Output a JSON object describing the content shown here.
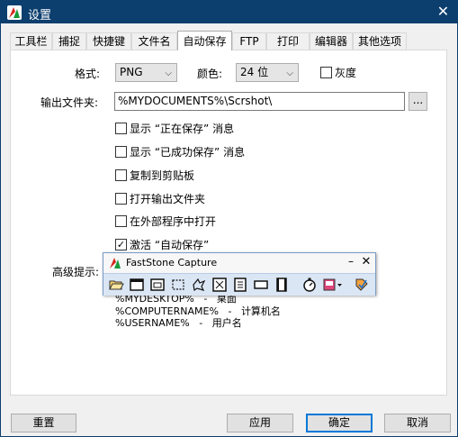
{
  "window": {
    "title": "设置",
    "close_glyph": "✕"
  },
  "tabs": [
    {
      "label": "工具栏"
    },
    {
      "label": "捕捉"
    },
    {
      "label": "快捷键"
    },
    {
      "label": "文件名"
    },
    {
      "label": "自动保存",
      "active": true
    },
    {
      "label": "FTP"
    },
    {
      "label": "打印"
    },
    {
      "label": "编辑器"
    },
    {
      "label": "其他选项"
    }
  ],
  "form": {
    "format_label": "格式:",
    "format_value": "PNG",
    "color_label": "颜色:",
    "color_value": "24 位",
    "grayscale_label": "灰度",
    "grayscale_checked": false,
    "output_folder_label": "输出文件夹:",
    "output_folder_value": "%MYDOCUMENTS%\\Scrshot\\",
    "browse_label": "...",
    "checkboxes": [
      {
        "label": "显示 “正在保存” 消息",
        "checked": false
      },
      {
        "label": "显示 “已成功保存” 消息",
        "checked": false
      },
      {
        "label": "复制到剪贴板",
        "checked": false
      },
      {
        "label": "打开输出文件夹",
        "checked": false
      },
      {
        "label": "在外部程序中打开",
        "checked": false
      },
      {
        "label": "激活 “自动保存”",
        "checked": true
      }
    ],
    "check_glyph": "✓",
    "advanced_hint_label": "高级提示:",
    "hints": [
      {
        "var": "%MYDESKTOP%",
        "sep": "-",
        "desc": "桌面"
      },
      {
        "var": "%COMPUTERNAME%",
        "sep": "-",
        "desc": "计算机名"
      },
      {
        "var": "%USERNAME%",
        "sep": "-",
        "desc": "用户名"
      }
    ]
  },
  "floating_toolbar": {
    "title": "FastStone Capture",
    "minimize_glyph": "–",
    "close_glyph": "✕",
    "tools": [
      "open-folder-icon",
      "capture-window-icon",
      "capture-object-icon",
      "capture-rectangle-icon",
      "capture-freehand-icon",
      "capture-fullscreen-icon",
      "capture-scrolling-icon",
      "capture-fixed-region-icon",
      "screen-recorder-icon",
      "delay-timer-icon",
      "output-destination-icon",
      "settings-menu-icon"
    ]
  },
  "buttons": {
    "reset": "重置",
    "apply": "应用",
    "ok": "确定",
    "cancel": "取消"
  }
}
